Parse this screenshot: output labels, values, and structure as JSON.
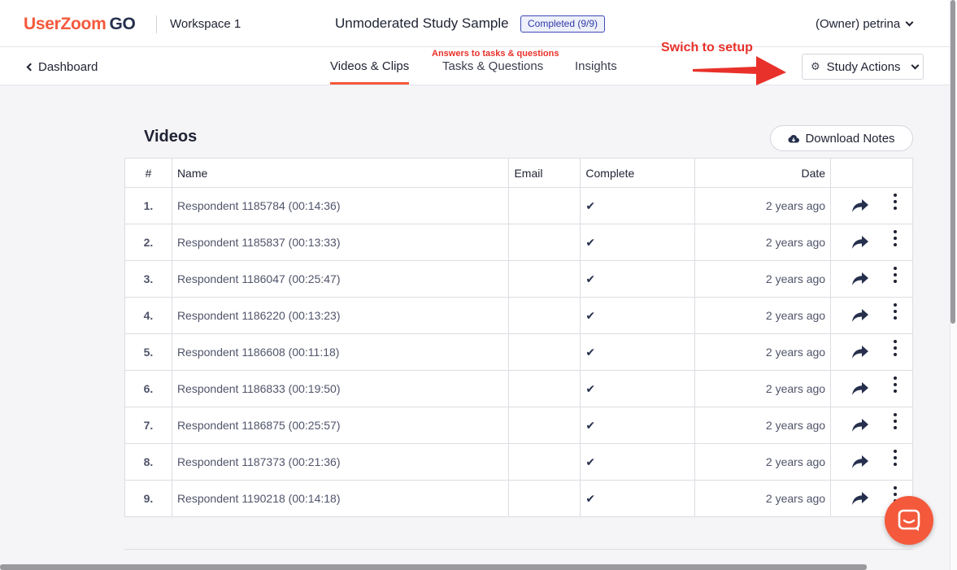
{
  "header": {
    "logo_main": "UserZoom",
    "logo_go": "GO",
    "workspace": "Workspace 1",
    "study_title": "Unmoderated Study Sample",
    "status": "Completed (9/9)",
    "owner": "(Owner) petrina"
  },
  "subnav": {
    "back_label": "Dashboard",
    "tabs": [
      {
        "label": "Videos & Clips",
        "active": true
      },
      {
        "label": "Tasks & Questions",
        "active": false
      },
      {
        "label": "Insights",
        "active": false
      }
    ],
    "annotation_tasks": "Answers to tasks & questions",
    "annotation_setup": "Swich to setup",
    "study_actions_label": "Study Actions"
  },
  "videos": {
    "title": "Videos",
    "download_label": "Download Notes",
    "columns": [
      "#",
      "Name",
      "Email",
      "Complete",
      "Date"
    ],
    "rows": [
      {
        "num": "1.",
        "name": "Respondent 1185784 (00:14:36)",
        "email": "",
        "date": "2 years ago"
      },
      {
        "num": "2.",
        "name": "Respondent 1185837 (00:13:33)",
        "email": "",
        "date": "2 years ago"
      },
      {
        "num": "3.",
        "name": "Respondent 1186047 (00:25:47)",
        "email": "",
        "date": "2 years ago"
      },
      {
        "num": "4.",
        "name": "Respondent 1186220 (00:13:23)",
        "email": "",
        "date": "2 years ago"
      },
      {
        "num": "5.",
        "name": "Respondent 1186608 (00:11:18)",
        "email": "",
        "date": "2 years ago"
      },
      {
        "num": "6.",
        "name": "Respondent 1186833 (00:19:50)",
        "email": "",
        "date": "2 years ago"
      },
      {
        "num": "7.",
        "name": "Respondent 1186875 (00:25:57)",
        "email": "",
        "date": "2 years ago"
      },
      {
        "num": "8.",
        "name": "Respondent 1187373 (00:21:36)",
        "email": "",
        "date": "2 years ago"
      },
      {
        "num": "9.",
        "name": "Respondent 1190218 (00:14:18)",
        "email": "",
        "date": "2 years ago"
      }
    ]
  },
  "icons": {
    "check": "✔",
    "gear": "⚙",
    "share": "share-arrow-icon",
    "more": "kebab-menu-icon",
    "chat": "chat-icon",
    "cloud": "cloud-download-icon"
  },
  "colors": {
    "brand": "#f4593c",
    "annotation": "#e8312a",
    "badge": "#3f4bb5"
  }
}
